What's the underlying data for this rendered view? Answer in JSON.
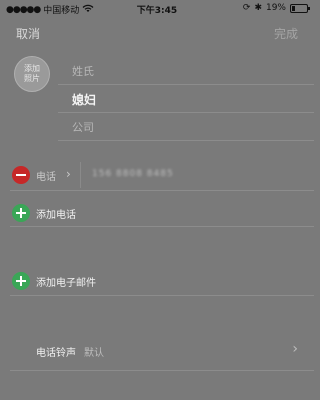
{
  "status": {
    "carrier": "中国移动",
    "time": "下午3:45",
    "battery_percent": "19%",
    "battery_level": 0.19
  },
  "nav": {
    "cancel": "取消",
    "done": "完成"
  },
  "contact": {
    "avatar_label": "添加\n照片",
    "last_name_placeholder": "姓氏",
    "first_name_value": "媳妇",
    "company_placeholder": "公司"
  },
  "phone": {
    "label": "电话",
    "number": "156 8808 8485"
  },
  "actions": {
    "add_phone": "添加电话",
    "add_email": "添加电子邮件"
  },
  "ringtone": {
    "label": "电话铃声",
    "value": "默认"
  },
  "icons": [
    "wifi-icon",
    "lock-rotation-icon",
    "bluetooth-icon",
    "battery-icon",
    "minus-icon",
    "plus-icon",
    "chevron-right-icon"
  ]
}
